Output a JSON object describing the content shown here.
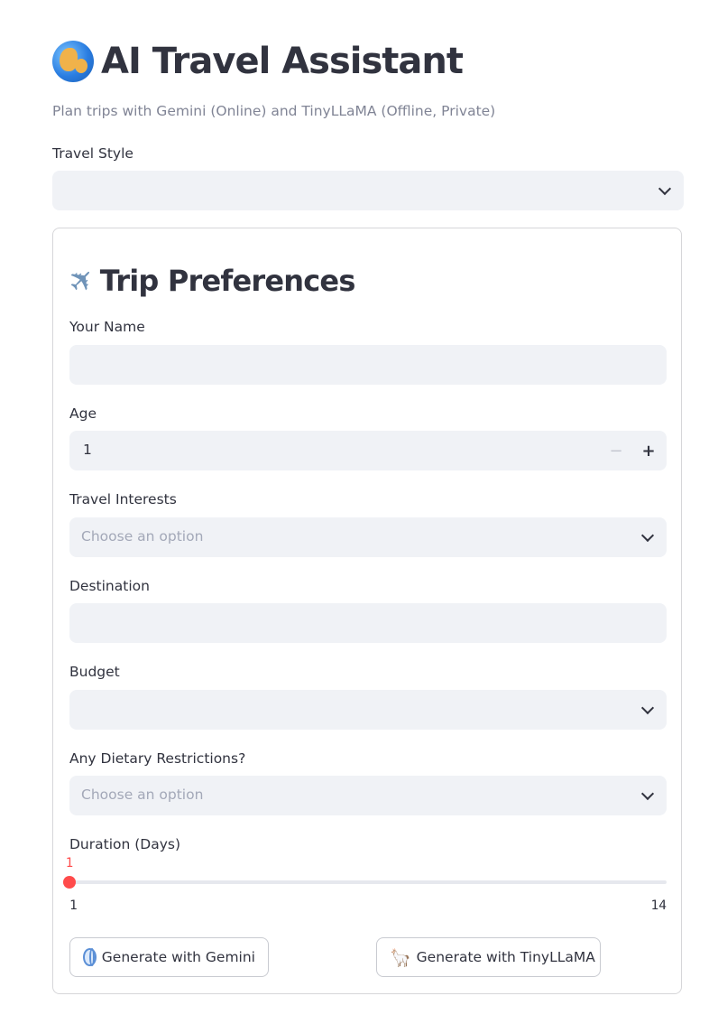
{
  "header": {
    "title": "AI Travel Assistant",
    "subtitle": "Plan trips with Gemini (Online) and TinyLLaMA (Offline, Private)"
  },
  "travel_style": {
    "label": "Travel Style",
    "value": ""
  },
  "form": {
    "title": "Trip Preferences",
    "name": {
      "label": "Your Name",
      "value": ""
    },
    "age": {
      "label": "Age",
      "value": "1",
      "minus": "−",
      "plus": "+"
    },
    "interests": {
      "label": "Travel Interests",
      "placeholder": "Choose an option"
    },
    "destination": {
      "label": "Destination",
      "value": ""
    },
    "budget": {
      "label": "Budget",
      "value": ""
    },
    "dietary": {
      "label": "Any Dietary Restrictions?",
      "placeholder": "Choose an option"
    },
    "duration": {
      "label": "Duration (Days)",
      "value": 1,
      "value_label": "1",
      "min": 1,
      "max": 14,
      "min_label": "1",
      "max_label": "14"
    },
    "buttons": {
      "gemini": "Generate with Gemini",
      "tinyllama": "Generate with TinyLLaMA"
    }
  },
  "colors": {
    "accent": "#ff4b4b",
    "field_bg": "#f0f2f6",
    "text": "#31333f",
    "muted": "#808495"
  },
  "icons": {
    "title": "globe-icon",
    "form_title": "airplane-icon",
    "gemini_button": "globe-with-meridians-icon",
    "tinyllama_button": "llama-icon"
  }
}
